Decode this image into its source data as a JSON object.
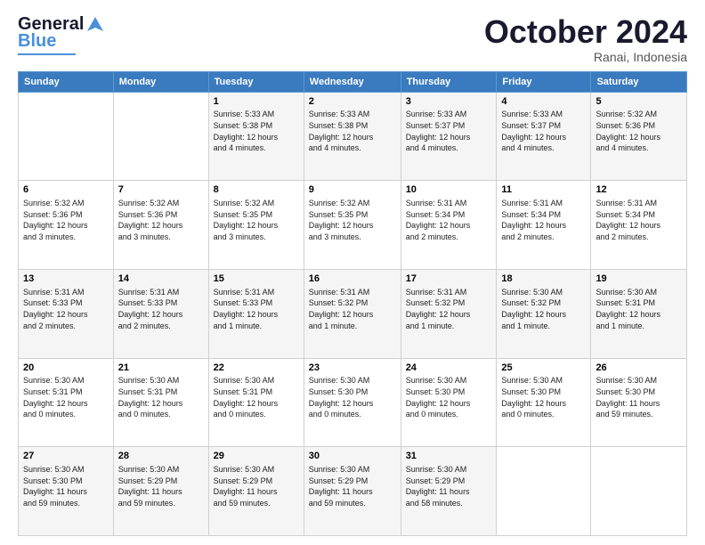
{
  "logo": {
    "line1": "General",
    "line2": "Blue"
  },
  "header": {
    "month": "October 2024",
    "location": "Ranai, Indonesia"
  },
  "weekdays": [
    "Sunday",
    "Monday",
    "Tuesday",
    "Wednesday",
    "Thursday",
    "Friday",
    "Saturday"
  ],
  "weeks": [
    [
      {
        "day": "",
        "info": ""
      },
      {
        "day": "",
        "info": ""
      },
      {
        "day": "1",
        "info": "Sunrise: 5:33 AM\nSunset: 5:38 PM\nDaylight: 12 hours\nand 4 minutes."
      },
      {
        "day": "2",
        "info": "Sunrise: 5:33 AM\nSunset: 5:38 PM\nDaylight: 12 hours\nand 4 minutes."
      },
      {
        "day": "3",
        "info": "Sunrise: 5:33 AM\nSunset: 5:37 PM\nDaylight: 12 hours\nand 4 minutes."
      },
      {
        "day": "4",
        "info": "Sunrise: 5:33 AM\nSunset: 5:37 PM\nDaylight: 12 hours\nand 4 minutes."
      },
      {
        "day": "5",
        "info": "Sunrise: 5:32 AM\nSunset: 5:36 PM\nDaylight: 12 hours\nand 4 minutes."
      }
    ],
    [
      {
        "day": "6",
        "info": "Sunrise: 5:32 AM\nSunset: 5:36 PM\nDaylight: 12 hours\nand 3 minutes."
      },
      {
        "day": "7",
        "info": "Sunrise: 5:32 AM\nSunset: 5:36 PM\nDaylight: 12 hours\nand 3 minutes."
      },
      {
        "day": "8",
        "info": "Sunrise: 5:32 AM\nSunset: 5:35 PM\nDaylight: 12 hours\nand 3 minutes."
      },
      {
        "day": "9",
        "info": "Sunrise: 5:32 AM\nSunset: 5:35 PM\nDaylight: 12 hours\nand 3 minutes."
      },
      {
        "day": "10",
        "info": "Sunrise: 5:31 AM\nSunset: 5:34 PM\nDaylight: 12 hours\nand 2 minutes."
      },
      {
        "day": "11",
        "info": "Sunrise: 5:31 AM\nSunset: 5:34 PM\nDaylight: 12 hours\nand 2 minutes."
      },
      {
        "day": "12",
        "info": "Sunrise: 5:31 AM\nSunset: 5:34 PM\nDaylight: 12 hours\nand 2 minutes."
      }
    ],
    [
      {
        "day": "13",
        "info": "Sunrise: 5:31 AM\nSunset: 5:33 PM\nDaylight: 12 hours\nand 2 minutes."
      },
      {
        "day": "14",
        "info": "Sunrise: 5:31 AM\nSunset: 5:33 PM\nDaylight: 12 hours\nand 2 minutes."
      },
      {
        "day": "15",
        "info": "Sunrise: 5:31 AM\nSunset: 5:33 PM\nDaylight: 12 hours\nand 1 minute."
      },
      {
        "day": "16",
        "info": "Sunrise: 5:31 AM\nSunset: 5:32 PM\nDaylight: 12 hours\nand 1 minute."
      },
      {
        "day": "17",
        "info": "Sunrise: 5:31 AM\nSunset: 5:32 PM\nDaylight: 12 hours\nand 1 minute."
      },
      {
        "day": "18",
        "info": "Sunrise: 5:30 AM\nSunset: 5:32 PM\nDaylight: 12 hours\nand 1 minute."
      },
      {
        "day": "19",
        "info": "Sunrise: 5:30 AM\nSunset: 5:31 PM\nDaylight: 12 hours\nand 1 minute."
      }
    ],
    [
      {
        "day": "20",
        "info": "Sunrise: 5:30 AM\nSunset: 5:31 PM\nDaylight: 12 hours\nand 0 minutes."
      },
      {
        "day": "21",
        "info": "Sunrise: 5:30 AM\nSunset: 5:31 PM\nDaylight: 12 hours\nand 0 minutes."
      },
      {
        "day": "22",
        "info": "Sunrise: 5:30 AM\nSunset: 5:31 PM\nDaylight: 12 hours\nand 0 minutes."
      },
      {
        "day": "23",
        "info": "Sunrise: 5:30 AM\nSunset: 5:30 PM\nDaylight: 12 hours\nand 0 minutes."
      },
      {
        "day": "24",
        "info": "Sunrise: 5:30 AM\nSunset: 5:30 PM\nDaylight: 12 hours\nand 0 minutes."
      },
      {
        "day": "25",
        "info": "Sunrise: 5:30 AM\nSunset: 5:30 PM\nDaylight: 12 hours\nand 0 minutes."
      },
      {
        "day": "26",
        "info": "Sunrise: 5:30 AM\nSunset: 5:30 PM\nDaylight: 11 hours\nand 59 minutes."
      }
    ],
    [
      {
        "day": "27",
        "info": "Sunrise: 5:30 AM\nSunset: 5:30 PM\nDaylight: 11 hours\nand 59 minutes."
      },
      {
        "day": "28",
        "info": "Sunrise: 5:30 AM\nSunset: 5:29 PM\nDaylight: 11 hours\nand 59 minutes."
      },
      {
        "day": "29",
        "info": "Sunrise: 5:30 AM\nSunset: 5:29 PM\nDaylight: 11 hours\nand 59 minutes."
      },
      {
        "day": "30",
        "info": "Sunrise: 5:30 AM\nSunset: 5:29 PM\nDaylight: 11 hours\nand 59 minutes."
      },
      {
        "day": "31",
        "info": "Sunrise: 5:30 AM\nSunset: 5:29 PM\nDaylight: 11 hours\nand 58 minutes."
      },
      {
        "day": "",
        "info": ""
      },
      {
        "day": "",
        "info": ""
      }
    ]
  ]
}
